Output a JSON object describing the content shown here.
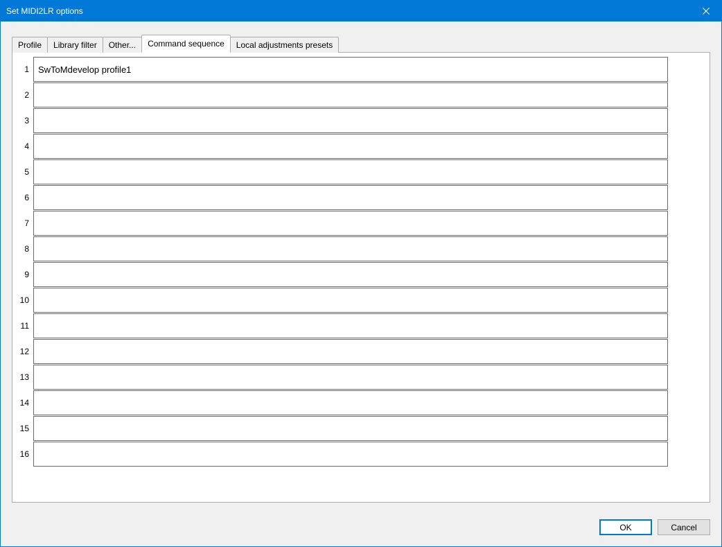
{
  "window": {
    "title": "Set MIDI2LR options"
  },
  "tabs": [
    {
      "label": "Profile",
      "active": false
    },
    {
      "label": "Library filter",
      "active": false
    },
    {
      "label": "Other...",
      "active": false
    },
    {
      "label": "Command sequence",
      "active": true
    },
    {
      "label": "Local adjustments presets",
      "active": false
    }
  ],
  "rows": [
    {
      "num": "1",
      "value": "SwToMdevelop profile1"
    },
    {
      "num": "2",
      "value": ""
    },
    {
      "num": "3",
      "value": ""
    },
    {
      "num": "4",
      "value": ""
    },
    {
      "num": "5",
      "value": ""
    },
    {
      "num": "6",
      "value": ""
    },
    {
      "num": "7",
      "value": ""
    },
    {
      "num": "8",
      "value": ""
    },
    {
      "num": "9",
      "value": ""
    },
    {
      "num": "10",
      "value": ""
    },
    {
      "num": "11",
      "value": ""
    },
    {
      "num": "12",
      "value": ""
    },
    {
      "num": "13",
      "value": ""
    },
    {
      "num": "14",
      "value": ""
    },
    {
      "num": "15",
      "value": ""
    },
    {
      "num": "16",
      "value": ""
    }
  ],
  "buttons": {
    "ok": "OK",
    "cancel": "Cancel"
  }
}
